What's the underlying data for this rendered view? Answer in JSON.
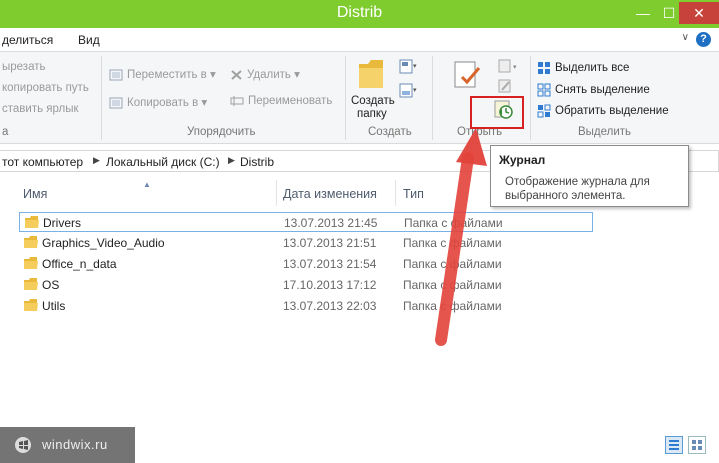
{
  "window": {
    "title": "Distrib",
    "minimize": "—",
    "maximize": "☐",
    "close": "✕"
  },
  "menu": {
    "share": "делиться",
    "view": "Вид",
    "help": "?",
    "chevron": "∨"
  },
  "ribbon": {
    "clipboard": {
      "cut": "ырезать",
      "copy_path": "копировать путь",
      "paste_shortcut": "ставить ярлык",
      "label": "а"
    },
    "organize": {
      "move_to": "Переместить в",
      "copy_to": "Копировать в",
      "delete": "Удалить",
      "rename": "Переименовать",
      "label": "Упорядочить"
    },
    "new": {
      "new_folder_line1": "Создать",
      "new_folder_line2": "папку",
      "label": "Создать"
    },
    "open": {
      "label": "Открыть"
    },
    "select": {
      "select_all": "Выделить все",
      "select_none": "Снять выделение",
      "invert": "Обратить выделение",
      "label": "Выделить"
    }
  },
  "address": {
    "parts": [
      "тот компьютер",
      "Локальный диск (C:)",
      "Distrib"
    ]
  },
  "columns": {
    "name": "Имя",
    "date": "Дата изменения",
    "type": "Тип"
  },
  "rows": [
    {
      "name": "Drivers",
      "date": "13.07.2013 21:45",
      "type": "Папка с файлами"
    },
    {
      "name": "Graphics_Video_Audio",
      "date": "13.07.2013 21:51",
      "type": "Папка с файлами"
    },
    {
      "name": "Office_n_data",
      "date": "13.07.2013 21:54",
      "type": "Папка с файлами"
    },
    {
      "name": "OS",
      "date": "17.10.2013 17:12",
      "type": "Папка с файлами"
    },
    {
      "name": "Utils",
      "date": "13.07.2013 22:03",
      "type": "Папка с файлами"
    }
  ],
  "tooltip": {
    "title": "Журнал",
    "text": "Отображение журнала для выбранного элемента."
  },
  "watermark": "windwix.ru",
  "colors": {
    "titlebar": "#7fcc2f",
    "arrow": "#e2423a",
    "highlight": "#d82020",
    "folder": "#e8b93a"
  }
}
